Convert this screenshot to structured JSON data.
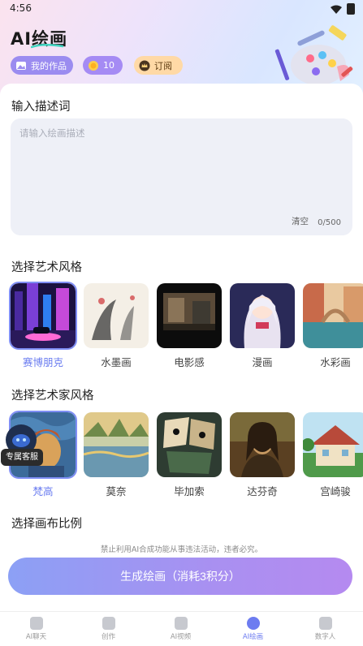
{
  "status": {
    "time": "4:56"
  },
  "header": {
    "title": "AI绘画",
    "my_works": "我的作品",
    "points": "10",
    "subscribe": "订阅"
  },
  "description": {
    "label": "输入描述词",
    "placeholder": "请输入绘画描述",
    "clear": "清空",
    "count": "0/500"
  },
  "art_style": {
    "label": "选择艺术风格",
    "items": [
      {
        "label": "赛博朋克",
        "selected": true
      },
      {
        "label": "水墨画",
        "selected": false
      },
      {
        "label": "电影感",
        "selected": false
      },
      {
        "label": "漫画",
        "selected": false
      },
      {
        "label": "水彩画",
        "selected": false
      }
    ]
  },
  "artist_style": {
    "label": "选择艺术家风格",
    "items": [
      {
        "label": "梵高",
        "selected": true
      },
      {
        "label": "莫奈",
        "selected": false
      },
      {
        "label": "毕加索",
        "selected": false
      },
      {
        "label": "达芬奇",
        "selected": false
      },
      {
        "label": "宫崎骏",
        "selected": false
      }
    ]
  },
  "canvas_ratio": {
    "label": "选择画布比例"
  },
  "customer_service": "专属客服",
  "notice": "禁止利用AI合成功能从事违法活动，违者必究。",
  "generate_button": "生成绘画（消耗3积分）",
  "tabs": [
    {
      "label": "AI聊天",
      "icon": "chat-icon"
    },
    {
      "label": "创作",
      "icon": "bulb-icon"
    },
    {
      "label": "AI视频",
      "icon": "video-icon"
    },
    {
      "label": "AI绘画",
      "icon": "palette-icon",
      "active": true
    },
    {
      "label": "数字人",
      "icon": "robot-icon"
    }
  ],
  "colors": {
    "accent": "#6d7cf0",
    "button_start": "#8ca0f5",
    "button_end": "#b58af0"
  }
}
